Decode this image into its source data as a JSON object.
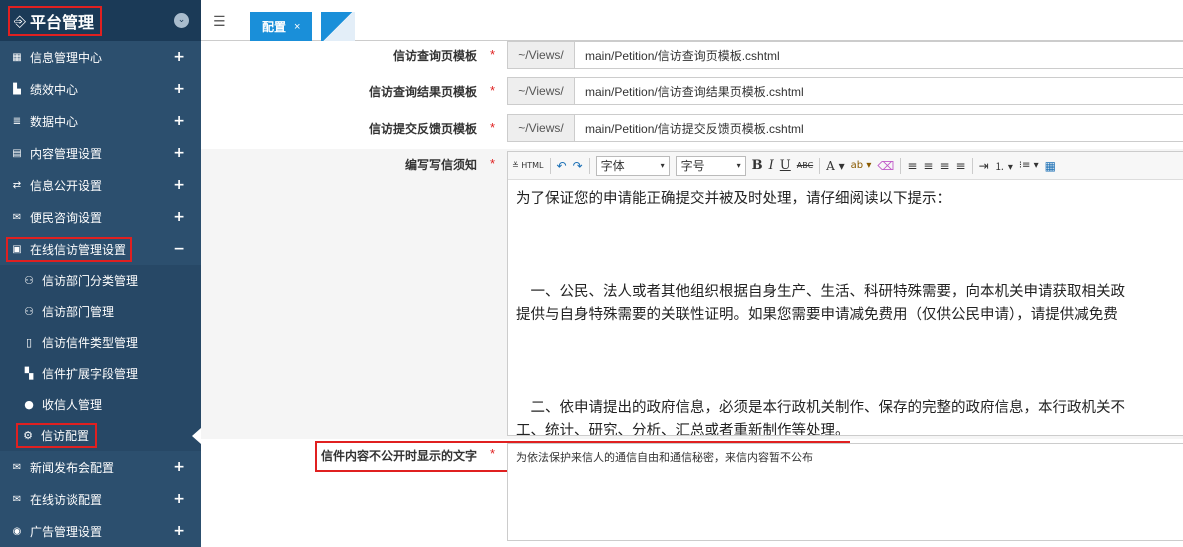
{
  "sidebar": {
    "brand_icon": "⎆",
    "brand_title": "平台管理",
    "toggle_icon": "⌄",
    "items": [
      {
        "label": "信息管理中心",
        "icon": "▦",
        "icon_name": "grid-icon",
        "expander": "+"
      },
      {
        "label": "绩效中心",
        "icon": "▙",
        "icon_name": "bar-chart-icon",
        "expander": "+"
      },
      {
        "label": "数据中心",
        "icon": "≣",
        "icon_name": "database-icon",
        "expander": "+"
      },
      {
        "label": "内容管理设置",
        "icon": "▤",
        "icon_name": "copy-icon",
        "expander": "+"
      },
      {
        "label": "信息公开设置",
        "icon": "⇄",
        "icon_name": "exchange-icon",
        "expander": "+"
      },
      {
        "label": "便民咨询设置",
        "icon": "✉",
        "icon_name": "envelope-icon",
        "expander": "+"
      },
      {
        "label": "在线信访管理设置",
        "icon": "▣",
        "icon_name": "inbox-icon",
        "expander": "−"
      }
    ],
    "sub_items": [
      {
        "label": "信访部门分类管理",
        "icon": "⚇",
        "icon_name": "sitemap-icon"
      },
      {
        "label": "信访部门管理",
        "icon": "⚇",
        "icon_name": "sitemap-icon"
      },
      {
        "label": "信访信件类型管理",
        "icon": "▯",
        "icon_name": "file-text-icon"
      },
      {
        "label": "信件扩展字段管理",
        "icon": "▚",
        "icon_name": "th-large-icon"
      },
      {
        "label": "收信人管理",
        "icon": "●",
        "icon_name": "user-icon"
      },
      {
        "label": "信访配置",
        "icon": "⚙",
        "icon_name": "cog-icon"
      }
    ],
    "items_after": [
      {
        "label": "新闻发布会配置",
        "icon": "✉",
        "icon_name": "envelope-icon",
        "expander": "+"
      },
      {
        "label": "在线访谈配置",
        "icon": "✉",
        "icon_name": "envelope-icon",
        "expander": "+"
      },
      {
        "label": "广告管理设置",
        "icon": "◉",
        "icon_name": "ad-icon",
        "expander": "+"
      }
    ]
  },
  "topbar": {
    "menu_icon": "☰",
    "tab_label": "配置",
    "tab_close": "×"
  },
  "form": {
    "required_mark": "*",
    "prefix": "~/Views/",
    "query_template": {
      "label": "信访查询页模板",
      "value": "main/Petition/信访查询页模板.cshtml"
    },
    "result_template": {
      "label": "信访查询结果页模板",
      "value": "main/Petition/信访查询结果页模板.cshtml"
    },
    "feedback_template": {
      "label": "信访提交反馈页模板",
      "value": "main/Petition/信访提交反馈页模板.cshtml"
    },
    "notice": {
      "label": "编写写信须知"
    },
    "hidden_text": {
      "label": "信件内容不公开时显示的文字",
      "value": "为依法保护来信人的通信自由和通信秘密，来信内容暂不公布"
    }
  },
  "editor": {
    "toolbar": {
      "html": "≚ HTML",
      "undo": "↶",
      "redo": "↷",
      "font_family": "字体",
      "font_size": "字号",
      "bold": "B",
      "italic": "I",
      "underline": "U",
      "strike": "ABC",
      "font_color": "A ▾",
      "highlight": "ab ▾",
      "eraser": "⌫",
      "align_left": "≡",
      "align_center": "≡",
      "align_right": "≡",
      "justify": "≡",
      "indent": "⇥",
      "ordered_list": "⒈ ▾",
      "unordered_list": "⁝≡ ▾",
      "table": "▦"
    },
    "paragraphs": [
      "为了保证您的申请能正确提交并被及时处理，请仔细阅读以下提示：",
      "　一、公民、法人或者其他组织根据自身生产、生活、科研特殊需要，向本机关申请获取相关政",
      "提供与自身特殊需要的关联性证明。如果您需要申请减免费用（仅供公民申请），请提供减免费",
      "　二、依申请提出的政府信息，必须是本行政机关制作、保存的完整的政府信息，本行政机关不",
      "工、统计、研究、分析、汇总或者重新制作等处理。"
    ]
  }
}
